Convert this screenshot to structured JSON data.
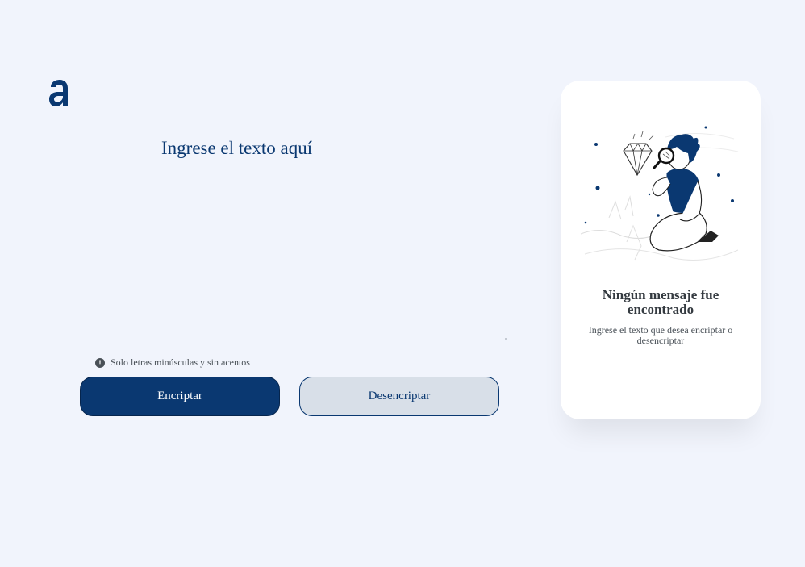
{
  "logo": {
    "icon": "alura-logo-icon",
    "color": "#0A3871"
  },
  "input": {
    "placeholder": "Ingrese el texto aquí",
    "value": ""
  },
  "hint": {
    "icon": "exclamation-circle-icon",
    "text": "Solo letras minúsculas y sin acentos"
  },
  "buttons": {
    "encrypt": "Encriptar",
    "decrypt": "Desencriptar"
  },
  "output": {
    "illustration": "person-with-magnifier-diamond-illustration",
    "title": "Ningún mensaje fue encontrado",
    "text": "Ingrese el texto que desea encriptar o desencriptar"
  },
  "colors": {
    "background": "#F1F4FC",
    "accent": "#0A3871",
    "secondary_button": "#D8DFE8",
    "card": "#FFFFFF"
  }
}
